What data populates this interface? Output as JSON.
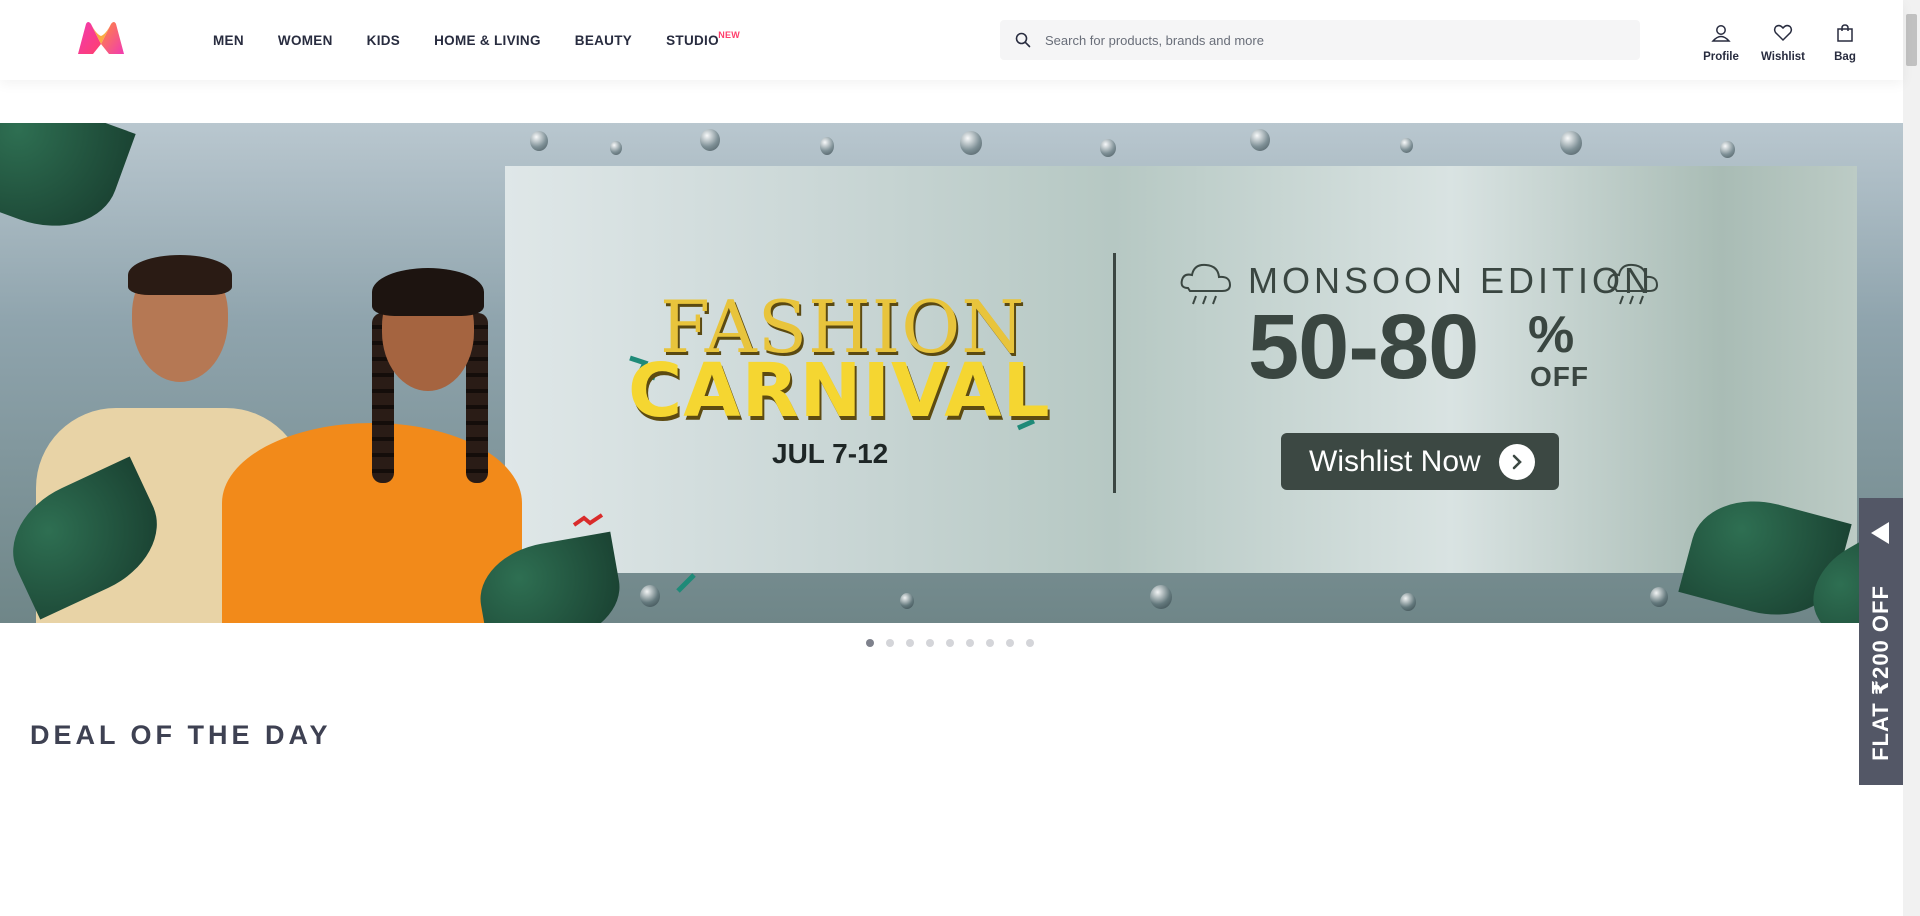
{
  "header": {
    "logo_icon": "myntra-logo-icon",
    "nav": [
      {
        "label": "MEN"
      },
      {
        "label": "WOMEN"
      },
      {
        "label": "KIDS"
      },
      {
        "label": "HOME & LIVING"
      },
      {
        "label": "BEAUTY"
      },
      {
        "label": "STUDIO",
        "badge": "NEW"
      }
    ],
    "search": {
      "placeholder": "Search for products, brands and more",
      "value": "",
      "icon": "search-icon"
    },
    "actions": [
      {
        "label": "Profile",
        "icon": "profile-icon"
      },
      {
        "label": "Wishlist",
        "icon": "heart-icon"
      },
      {
        "label": "Bag",
        "icon": "bag-icon"
      }
    ]
  },
  "banner": {
    "line1": "FASHION",
    "line2": "CARNIVAL",
    "dates": "JUL 7-12",
    "edition": "MONSOON EDITION",
    "discount": "50-80",
    "percent": "%",
    "off": "OFF",
    "cta": "Wishlist Now",
    "slide_count": 9,
    "active_slide": 1
  },
  "section": {
    "title": "DEAL OF THE DAY"
  },
  "side_tab": {
    "label": "FLAT ₹200 OFF"
  },
  "colors": {
    "brand_pink": "#ff3f6c",
    "text_dark": "#282c3f",
    "side_tab_bg": "#535766"
  }
}
